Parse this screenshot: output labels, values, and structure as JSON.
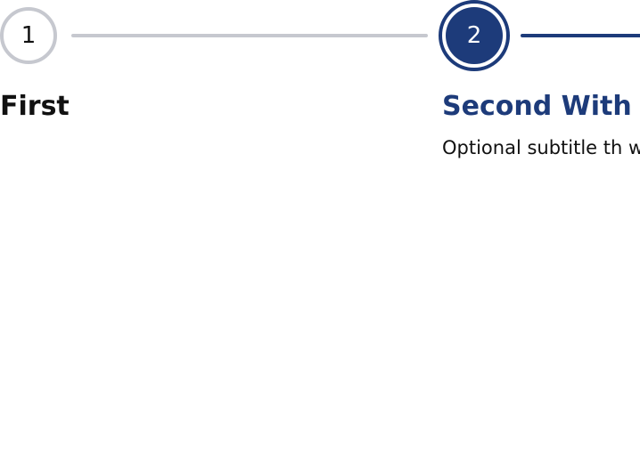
{
  "steps": [
    {
      "number": "1",
      "title": "First",
      "state": "inactive"
    },
    {
      "number": "2",
      "title": "Second With a",
      "subtitle": "Optional subtitle th wrap",
      "state": "active"
    }
  ],
  "colors": {
    "active": "#1d3b7a",
    "inactive": "#c6c8cf",
    "text": "#111111"
  }
}
